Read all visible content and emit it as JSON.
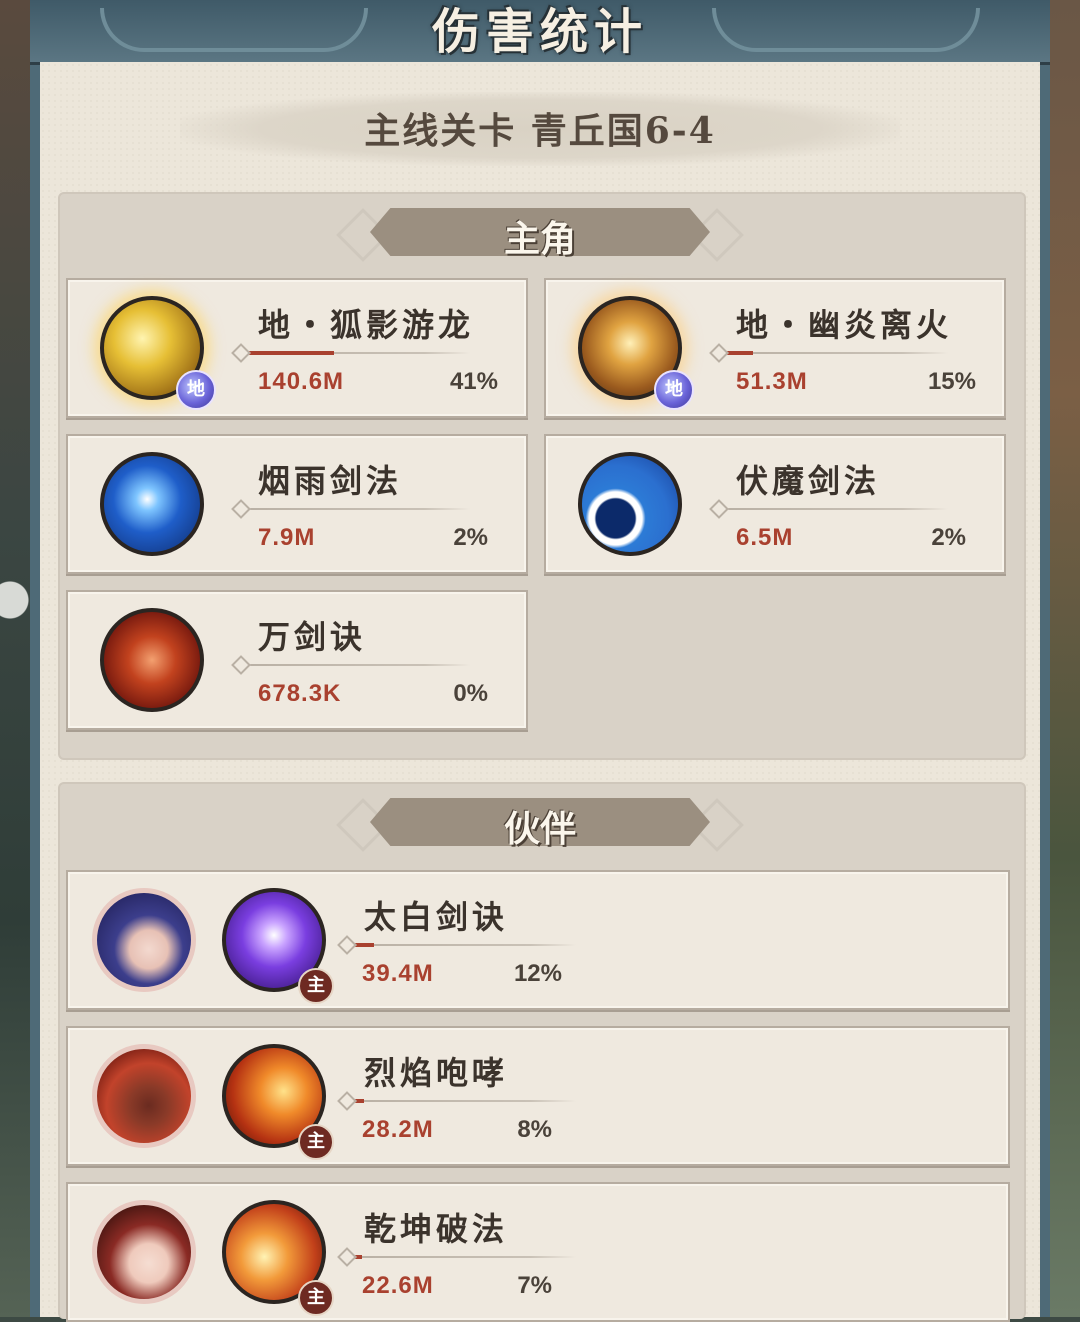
{
  "header": {
    "title": "伤害统计"
  },
  "stage": {
    "title": "主线关卡 青丘国6-4"
  },
  "sections": {
    "main": {
      "label": "主角"
    },
    "partner": {
      "label": "伙伴"
    }
  },
  "badges": {
    "earth": "地",
    "main": "主"
  },
  "main_skills": [
    {
      "name": "地・狐影游龙",
      "damage": "140.6M",
      "percent": "41%",
      "icon": "golden-dragon-skill-icon",
      "share": 0.41
    },
    {
      "name": "地・幽炎离火",
      "damage": "51.3M",
      "percent": "15%",
      "icon": "flame-sword-skill-icon",
      "share": 0.15
    },
    {
      "name": "烟雨剑法",
      "damage": "7.9M",
      "percent": "2%",
      "icon": "blue-burst-skill-icon",
      "share": 0.02
    },
    {
      "name": "伏魔剑法",
      "damage": "6.5M",
      "percent": "2%",
      "icon": "blue-wave-skill-icon",
      "share": 0.02
    },
    {
      "name": "万剑诀",
      "damage": "678.3K",
      "percent": "0%",
      "icon": "red-swords-skill-icon",
      "share": 0.0
    }
  ],
  "partners": [
    {
      "skill": "太白剑诀",
      "damage": "39.4M",
      "percent": "12%",
      "portrait": "blue-haired-swordsman-portrait",
      "icon": "purple-sword-skill-icon",
      "share": 0.12
    },
    {
      "skill": "烈焰咆哮",
      "damage": "28.2M",
      "percent": "8%",
      "portrait": "red-lion-beast-portrait",
      "icon": "fire-roar-skill-icon",
      "share": 0.08
    },
    {
      "skill": "乾坤破法",
      "damage": "22.6M",
      "percent": "7%",
      "portrait": "red-haired-girl-portrait",
      "icon": "fire-blast-skill-icon",
      "share": 0.07
    }
  ],
  "colors": {
    "damage": "#a9412f",
    "paper": "#ece6da",
    "frame": "#4e6a77"
  }
}
